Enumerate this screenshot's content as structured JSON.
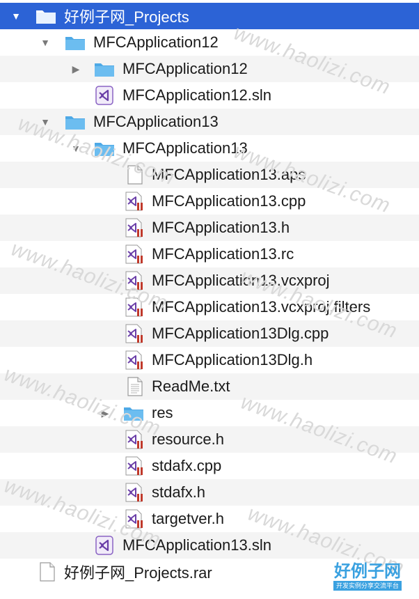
{
  "tree": [
    {
      "label": "好例子网_Projects",
      "type": "folder",
      "expanded": true,
      "selected": true
    },
    {
      "label": "MFCApplication12",
      "type": "folder",
      "expanded": true
    },
    {
      "label": "MFCApplication12",
      "type": "folder",
      "expanded": false
    },
    {
      "label": "MFCApplication12.sln",
      "type": "vs-solution"
    },
    {
      "label": "MFCApplication13",
      "type": "folder",
      "expanded": true
    },
    {
      "label": "MFCApplication13",
      "type": "folder",
      "expanded": true
    },
    {
      "label": "MFCApplication13.aps",
      "type": "blank-doc"
    },
    {
      "label": "MFCApplication13.cpp",
      "type": "vs-source"
    },
    {
      "label": "MFCApplication13.h",
      "type": "vs-source"
    },
    {
      "label": "MFCApplication13.rc",
      "type": "vs-source"
    },
    {
      "label": "MFCApplication13.vcxproj",
      "type": "vs-source"
    },
    {
      "label": "MFCApplication13.vcxproj.filters",
      "type": "vs-source"
    },
    {
      "label": "MFCApplication13Dlg.cpp",
      "type": "vs-source"
    },
    {
      "label": "MFCApplication13Dlg.h",
      "type": "vs-source"
    },
    {
      "label": "ReadMe.txt",
      "type": "text-doc"
    },
    {
      "label": "res",
      "type": "folder",
      "expanded": false
    },
    {
      "label": "resource.h",
      "type": "vs-source"
    },
    {
      "label": "stdafx.cpp",
      "type": "vs-source"
    },
    {
      "label": "stdafx.h",
      "type": "vs-source"
    },
    {
      "label": "targetver.h",
      "type": "vs-source"
    },
    {
      "label": "MFCApplication13.sln",
      "type": "vs-solution"
    },
    {
      "label": "好例子网_Projects.rar",
      "type": "blank-doc"
    }
  ],
  "watermark": "www.haolizi.com",
  "logo": {
    "main": "好例子网",
    "sub": "开发实例分享交流平台"
  },
  "colors": {
    "selection": "#2c63d6",
    "folder": "#5fb4ea",
    "vs_purple": "#6b3fa8",
    "vs_red": "#c0392b"
  }
}
